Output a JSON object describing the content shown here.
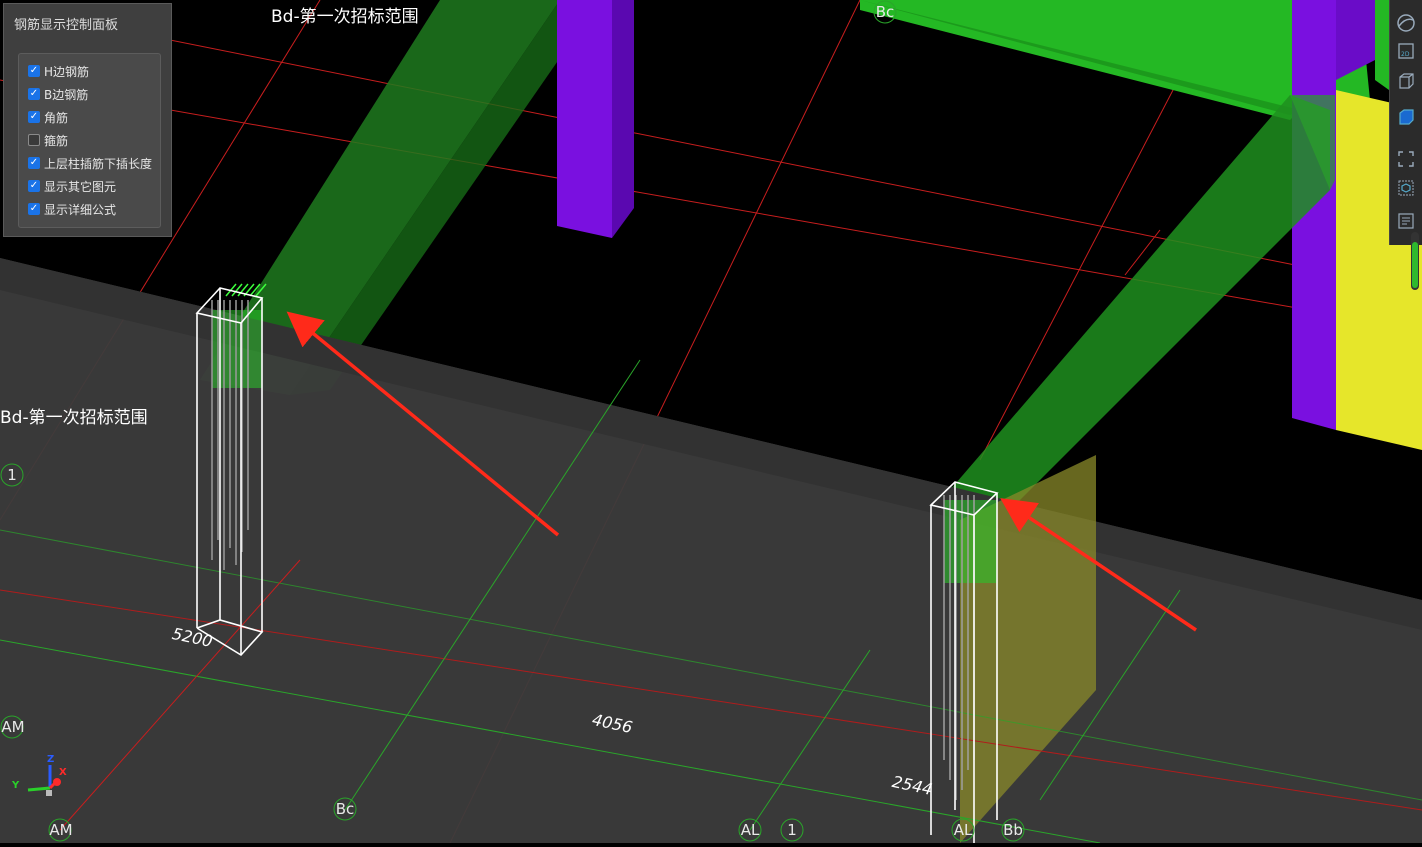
{
  "panel": {
    "title": "钢筋显示控制面板",
    "options": [
      {
        "label": "H边钢筋",
        "checked": true
      },
      {
        "label": "B边钢筋",
        "checked": true
      },
      {
        "label": "角筋",
        "checked": true
      },
      {
        "label": "箍筋",
        "checked": false
      },
      {
        "label": "上层柱插筋下插长度",
        "checked": true
      },
      {
        "label": "显示其它图元",
        "checked": true
      },
      {
        "label": "显示详细公式",
        "checked": true
      }
    ]
  },
  "scene": {
    "region_label_top": "Bd-第一次招标范围",
    "region_label_left": "Bd-第一次招标范围",
    "axis_labels": {
      "bc_top": "Bc",
      "one_left": "1",
      "am_left": "AM",
      "am_bottom": "AM",
      "bc_bottom": "Bc",
      "al_bottom": "AL",
      "one_bottom": "1",
      "al_bottom2": "AL",
      "bb_bottom": "Bb"
    },
    "dimensions": {
      "d1": "5200",
      "d2": "4056",
      "d3": "2544"
    },
    "gizmo": {
      "z": "Z",
      "x": "X",
      "y": "Y"
    },
    "colors": {
      "background": "#000000",
      "slab": "#3c3c3c",
      "beam_green": "#1f8f1f",
      "column_purple": "#7a10e0",
      "column_yellow": "#e6e62a",
      "slab_green": "#22b822",
      "grid_red": "#d42020",
      "grid_green": "#2aa52a",
      "arrow_red": "#ff2a1a"
    }
  },
  "toolbar": {
    "icons": [
      "orbit-icon",
      "view-2d-icon",
      "cube-wire-icon",
      "cube-solid-icon",
      "fit-view-icon",
      "box-select-icon",
      "list-settings-icon"
    ]
  }
}
